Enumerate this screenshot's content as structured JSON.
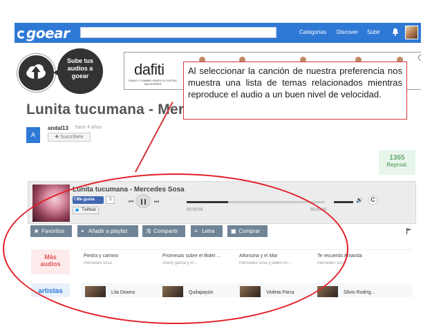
{
  "topbar": {
    "logo": "goear",
    "nav": [
      "Categorías",
      "Discover",
      "Subir"
    ]
  },
  "upload_badge": {
    "text": [
      "Sube tus",
      "audios a",
      "goear"
    ]
  },
  "ad": {
    "brand": "dafiti",
    "tagline": "ENVIO Y CAMBIO GRATIS 6 CUOTAS SIN INTERES",
    "info": "i"
  },
  "page_title": "Lunita tucumana - Mer",
  "uploader": {
    "avatar_letter": "A",
    "name": "andal13",
    "time": "hace 4 años",
    "subscribe": "✚ Suscríbete"
  },
  "plays": {
    "count": "1365",
    "label": "Reprod."
  },
  "player": {
    "title": "Lunita tucumana - Mercedes Sosa",
    "fb_like": "Me gusta",
    "fb_count": "3",
    "twitter": "Twittear",
    "time_current": "00:00:03",
    "time_total": "00:00:10",
    "progress_fraction": 0.3,
    "volume_fraction": 1.0,
    "repeat": "C"
  },
  "actions": [
    {
      "icon": "★",
      "label": "Favoritos"
    },
    {
      "icon": "+",
      "label": "Añadir a playlist"
    },
    {
      "icon": "⤨",
      "label": "Compartir"
    },
    {
      "icon": "≡",
      "label": "Letra"
    },
    {
      "icon": "▣",
      "label": "Comprar"
    }
  ],
  "related": {
    "label": [
      "Más",
      "audios"
    ],
    "items": [
      {
        "title": "Piedra y camino",
        "artist": "mercedes sosa"
      },
      {
        "title": "Promesas sobre el Bidet ...",
        "artist": "charly garcia y m..."
      },
      {
        "title": "Alfonsina y el Mar",
        "artist": "mercedes sosa y pablo mi..."
      },
      {
        "title": "Te recuerdo Amanda",
        "artist": "mercedes sosa"
      }
    ]
  },
  "artists": {
    "label": "artistas",
    "items": [
      "Lila Downs",
      "Quilapayún",
      "Violeta Parra",
      "Silvio Rodríg..."
    ]
  },
  "annotation": "Al seleccionar la canción de nuestra preferencia nos muestra una lista de temas relacionados mientras reproduce el audio a un buen nivel de velocidad.",
  "colors": {
    "brand": "#2f79d6",
    "annotation": "#e21d25",
    "action": "#6f8496"
  }
}
